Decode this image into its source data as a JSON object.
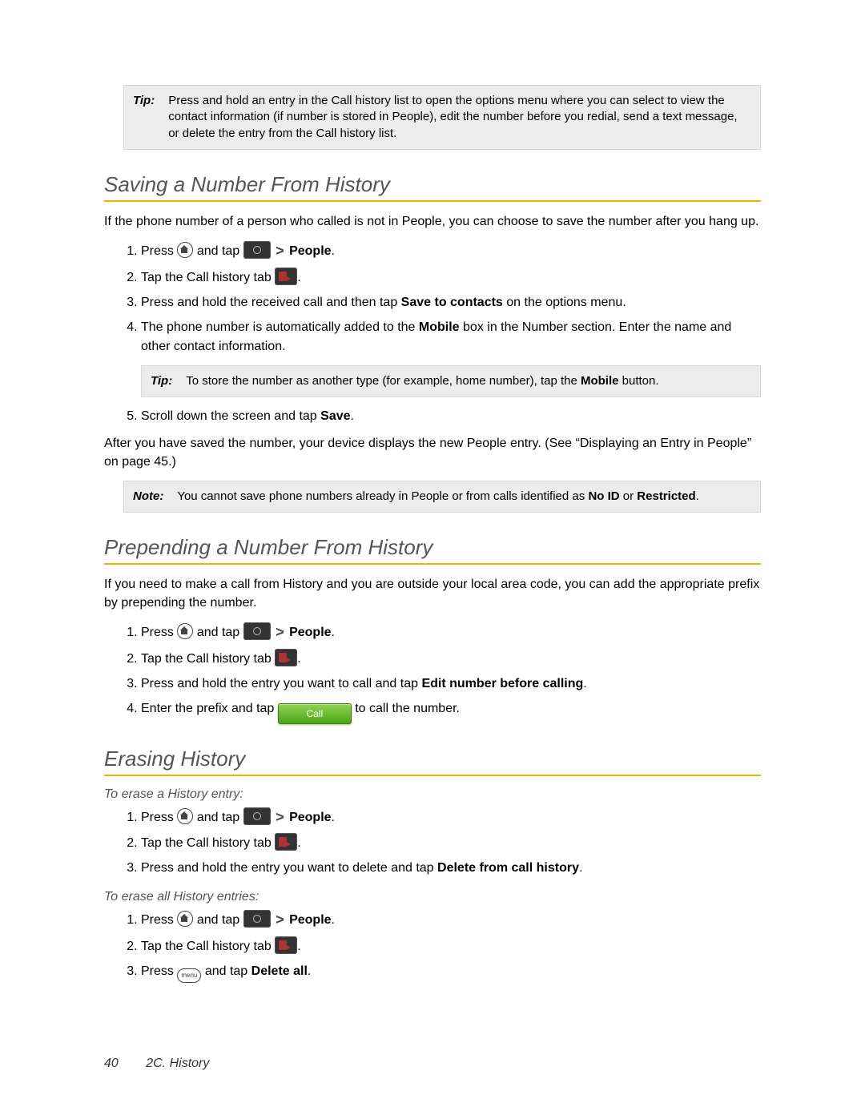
{
  "topTip": {
    "label": "Tip:",
    "text": "Press and hold an entry in the Call history list to open the options menu where you can select to view the contact information (if number is stored in People), edit the number before you redial, send a text message, or delete the entry from the Call history list."
  },
  "saving": {
    "title": "Saving a Number From History",
    "intro": "If the phone number of a person who called is not in People, you can choose to save the number after you hang up.",
    "step1a": "Press",
    "step1b": "and tap",
    "peopleLabel": "People",
    "step2": "Tap the Call history tab",
    "step3a": "Press and hold the received call and then tap",
    "step3bold": "Save to contacts",
    "step3b": "on the options menu.",
    "step4a": "The phone number is automatically added to the",
    "step4bold": "Mobile",
    "step4b": "box in the Number section. Enter the name and other contact information.",
    "tip": {
      "label": "Tip:",
      "a": "To store the number as another type (for example, home number), tap the",
      "bold": "Mobile",
      "b": "button."
    },
    "step5a": "Scroll down the screen and tap",
    "step5bold": "Save",
    "outroA": "After you have saved the number, your device displays the new People entry. (See “Displaying an Entry in People” on page 45.)",
    "note": {
      "label": "Note:",
      "a": "You cannot save phone numbers already in People or from calls identified as",
      "b1": "No ID",
      "mid": "or",
      "b2": "Restricted"
    }
  },
  "prepending": {
    "title": "Prepending a Number From History",
    "intro": "If you need to make a call from History and you are outside your local area code, you can add the appropriate prefix by prepending the number.",
    "step1a": "Press",
    "step1b": "and tap",
    "peopleLabel": "People",
    "step2": "Tap the Call history tab",
    "step3a": "Press and hold the entry you want to call and tap",
    "step3bold": "Edit number before calling",
    "step4a": "Enter the prefix and tap",
    "callLabel": "Call",
    "step4b": "to call the number."
  },
  "erasing": {
    "title": "Erasing History",
    "sub1": "To erase a History entry:",
    "s1_1a": "Press",
    "s1_1b": "and tap",
    "peopleLabel": "People",
    "s1_2": "Tap the Call history tab",
    "s1_3a": "Press and hold the entry you want to delete and tap",
    "s1_3bold": "Delete from call history",
    "sub2": "To erase all History entries:",
    "s2_1a": "Press",
    "s2_1b": "and tap",
    "s2_2": "Tap the Call history tab",
    "s2_3a": "Press",
    "menuLabel": "menu",
    "s2_3b": "and tap",
    "s2_3bold": "Delete all"
  },
  "footer": {
    "page": "40",
    "section": "2C. History"
  }
}
